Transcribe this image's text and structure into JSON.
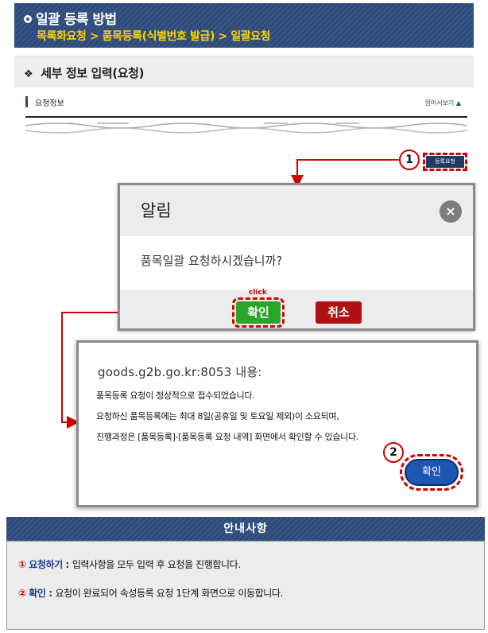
{
  "header": {
    "title": "일괄 등록 방법",
    "path": "목록화요청 > 품목등록(식별번호 발급) > 일괄요청"
  },
  "section": {
    "title": "세부 정보 입력(요청)"
  },
  "request_info": {
    "label": "요청정보",
    "fold_label": "접어서보기"
  },
  "register_button": {
    "label": "등록요청"
  },
  "step_markers": [
    "1",
    "2"
  ],
  "alert": {
    "title": "알림",
    "close": "×",
    "message": "품목일괄 요청하시겠습니까?",
    "ok": "확인",
    "cancel": "취소",
    "click_label": "click"
  },
  "browser_dialog": {
    "title": "goods.g2b.go.kr:8053 내용:",
    "lines": [
      "품목등록 요청이 정상적으로 접수되었습니다.",
      "요청하신 품목등록에는 최대 8일(공휴일 및 토요일 제외)이 소요되며,",
      "진행과정은 [품목등록]-[품목등록 요청 내역] 화면에서 확인할 수 있습니다."
    ],
    "ok": "확인"
  },
  "guide": {
    "title": "안내사항",
    "items": [
      {
        "mark": "①",
        "key": "요청하기",
        "sep": " : ",
        "text": "입력사항을 모두 입력 후 요청을 진행합니다."
      },
      {
        "mark": "②",
        "key": "확인",
        "sep": " : ",
        "text": "요청이 완료되어 속성등록 요청 1단계 화면으로 이동합니다."
      }
    ]
  },
  "colors": {
    "banner": "#2c4a7a",
    "path_text": "#ffd400",
    "highlight": "#d00000",
    "ok_green": "#2aa52a",
    "cancel_red": "#b01212",
    "browser_ok_blue": "#1f56b0"
  }
}
